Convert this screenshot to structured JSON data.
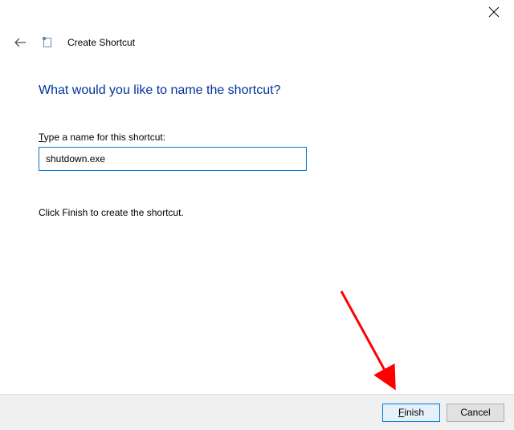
{
  "window": {
    "title": "Create Shortcut"
  },
  "page": {
    "heading": "What would you like to name the shortcut?",
    "field_label_prefix_underlined": "T",
    "field_label_rest": "ype a name for this shortcut:",
    "input_value": "shutdown.exe",
    "instruction": "Click Finish to create the shortcut."
  },
  "buttons": {
    "finish_underlined": "F",
    "finish_rest": "inish",
    "cancel": "Cancel"
  },
  "annotation": {
    "arrow_color": "#ff0000"
  }
}
